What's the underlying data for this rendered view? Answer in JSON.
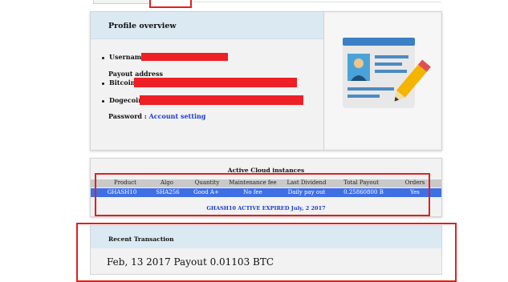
{
  "profile": {
    "title": "Profile overview",
    "username_label": "Username :",
    "payout_label": "Payout address",
    "bitcoin_label": "Bitcoin :",
    "dogecoin_label": "Dogecoin :",
    "password_label": "Password :",
    "account_setting": "Account setting"
  },
  "cloud": {
    "title": "Active Cloud instances",
    "headers": [
      "Product",
      "Algo",
      "Quantity",
      "Maintenance fee",
      "Last Dividend",
      "Total Payout",
      "Orders"
    ],
    "row": [
      "GHASH10",
      "SHA256",
      "Good A+",
      "No fee",
      "Daily pay out",
      "0.25860800 B",
      "Yes"
    ],
    "footer": "GHASH10 ACTIVE EXPIRED July, 2 2017"
  },
  "transactions": {
    "title": "Recent Transaction",
    "entry": "Feb, 13 2017 Payout 0.01103 BTC"
  },
  "colors": {
    "header_bg": "#dbe9f3",
    "highlight_row": "#3f6fe4",
    "redaction": "#ee1f25",
    "annotation": "#e02020",
    "link": "#1a3bd1"
  }
}
